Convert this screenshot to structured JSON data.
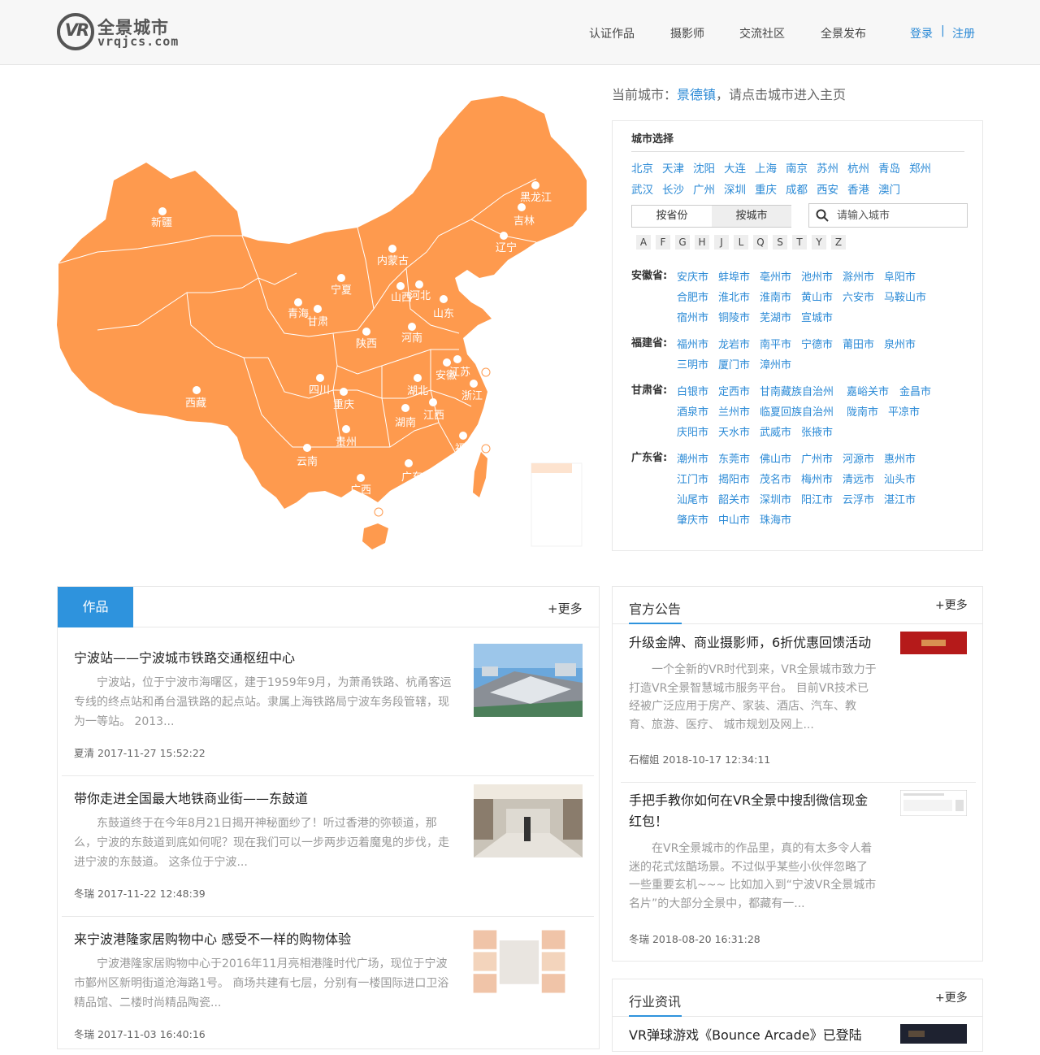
{
  "header": {
    "logo_cn": "全景城市",
    "logo_vr": "VR",
    "logo_en": "vrqjcs.com",
    "nav": [
      "认证作品",
      "摄影师",
      "交流社区",
      "全景发布"
    ],
    "login": "登录",
    "separator": "|",
    "register": "注册"
  },
  "map": {
    "provinces": [
      "新疆",
      "黑龙江",
      "吉林",
      "辽宁",
      "内蒙古",
      "宁夏",
      "山西",
      "河北",
      "青海",
      "甘肃",
      "山东",
      "陕西",
      "河南",
      "西藏",
      "四川",
      "重庆",
      "湖北",
      "安徽",
      "江苏",
      "浙江",
      "贵州",
      "湖南",
      "江西",
      "云南",
      "广西",
      "广东",
      "福建"
    ]
  },
  "current_city": {
    "label": "当前城市：",
    "city": "景德镇",
    "hint": "，请点击城市进入主页"
  },
  "city_select": {
    "title": "城市选择",
    "hot_row1": [
      "北京",
      "天津",
      "沈阳",
      "大连",
      "上海",
      "南京",
      "苏州",
      "杭州",
      "青岛",
      "郑州"
    ],
    "hot_row2": [
      "武汉",
      "长沙",
      "广州",
      "深圳",
      "重庆",
      "成都",
      "西安",
      "香港",
      "澳门"
    ],
    "tab_province": "按省份",
    "tab_city": "按城市",
    "search_placeholder": "请输入城市",
    "letters": [
      "A",
      "F",
      "G",
      "H",
      "J",
      "L",
      "Q",
      "S",
      "T",
      "Y",
      "Z"
    ],
    "provinces": [
      {
        "name": "安徽省:",
        "cities": [
          [
            "安庆市",
            "蚌埠市",
            "亳州市",
            "池州市",
            "滁州市",
            "阜阳市"
          ],
          [
            "合肥市",
            "淮北市",
            "淮南市",
            "黄山市",
            "六安市",
            "马鞍山市"
          ],
          [
            "宿州市",
            "铜陵市",
            "芜湖市",
            "宣城市"
          ]
        ]
      },
      {
        "name": "福建省:",
        "cities": [
          [
            "福州市",
            "龙岩市",
            "南平市",
            "宁德市",
            "莆田市",
            "泉州市"
          ],
          [
            "三明市",
            "厦门市",
            "漳州市"
          ]
        ]
      },
      {
        "name": "甘肃省:",
        "cities": [
          [
            "白银市",
            "定西市",
            "甘南藏族自治州",
            "嘉峪关市",
            "金昌市"
          ],
          [
            "酒泉市",
            "兰州市",
            "临夏回族自治州",
            "陇南市",
            "平凉市"
          ],
          [
            "庆阳市",
            "天水市",
            "武威市",
            "张掖市"
          ]
        ]
      },
      {
        "name": "广东省:",
        "cities": [
          [
            "潮州市",
            "东莞市",
            "佛山市",
            "广州市",
            "河源市",
            "惠州市"
          ],
          [
            "江门市",
            "揭阳市",
            "茂名市",
            "梅州市",
            "清远市",
            "汕头市"
          ],
          [
            "汕尾市",
            "韶关市",
            "深圳市",
            "阳江市",
            "云浮市",
            "湛江市"
          ],
          [
            "肇庆市",
            "中山市",
            "珠海市"
          ]
        ]
      }
    ]
  },
  "works": {
    "tab": "作品",
    "more": "+更多",
    "items": [
      {
        "title": "宁波站——宁波城市铁路交通枢纽中心",
        "desc": "宁波站，位于宁波市海曙区，建于1959年9月，为萧甬铁路、杭甬客运专线的终点站和甬台温铁路的起点站。隶属上海铁路局宁波车务段管辖，现为一等站。 2013...",
        "meta": "夏清 2017-11-27 15:52:22"
      },
      {
        "title": "带你走进全国最大地铁商业街——东鼓道",
        "desc": "东鼓道终于在今年8月21日揭开神秘面纱了！听过香港的弥顿道，那么，宁波的东鼓道到底如何呢？现在我们可以一步两步迈着魔鬼的步伐，走进宁波的东鼓道。 这条位于宁波...",
        "meta": "冬瑞 2017-11-22 12:48:39"
      },
      {
        "title": "来宁波港隆家居购物中心 感受不一样的购物体验",
        "desc": "宁波港隆家居购物中心于2016年11月亮相港隆时代广场，现位于宁波市鄞州区新明街道沧海路1号。 商场共建有七层，分别有一楼国际进口卫浴精品馆、二楼时尚精品陶瓷...",
        "meta": "冬瑞 2017-11-03 16:40:16"
      }
    ]
  },
  "notices": {
    "title": "官方公告",
    "more": "+更多",
    "items": [
      {
        "title": "升级金牌、商业摄影师，6折优惠回馈活动",
        "desc": "一个全新的VR时代到来，VR全景城市致力于打造VR全景智慧城市服务平台。 目前VR技术已经被广泛应用于房产、家装、酒店、汽车、教育、旅游、医疗、 城市规划及网上...",
        "meta": "石榴姐 2018-10-17 12:34:11"
      },
      {
        "title": "手把手教你如何在VR全景中搜刮微信现金红包！",
        "desc": "在VR全景城市的作品里，真的有太多令人着迷的花式炫酷场景。不过似乎某些小伙伴忽略了一些重要玄机~~~ 比如加入到“宁波VR全景城市名片”的大部分全景中，都藏有一...",
        "meta": "冬瑞 2018-08-20 16:31:28"
      }
    ]
  },
  "industry": {
    "title": "行业资讯",
    "more": "+更多",
    "items": [
      {
        "title": "VR弹球游戏《Bounce Arcade》已登陆"
      }
    ]
  },
  "colors": {
    "accent": "#2e93dd",
    "link": "#2b8ad6",
    "map_fill": "#fe9a4e"
  }
}
